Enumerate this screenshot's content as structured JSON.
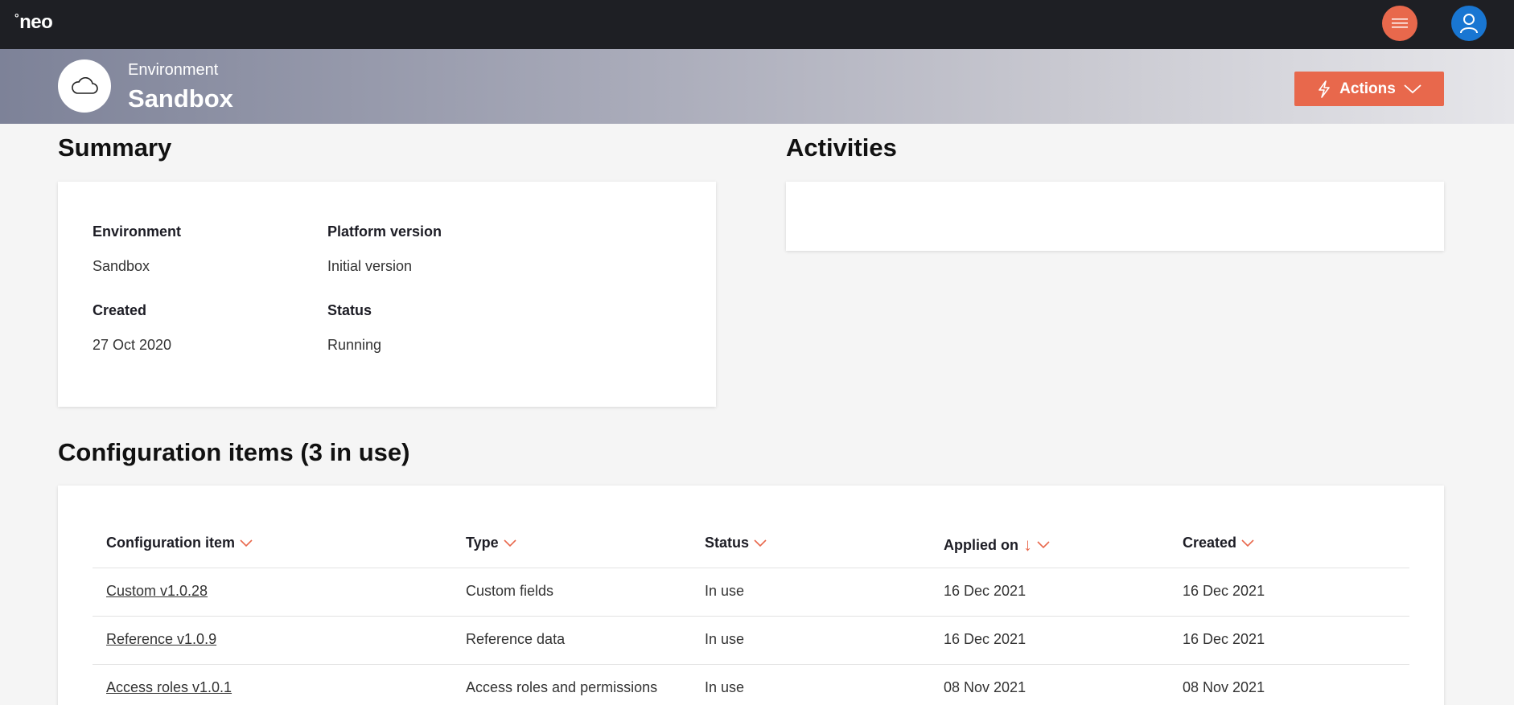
{
  "topbar": {
    "logo_mark": "°",
    "logo_text": "neo",
    "menu_icon": "hamburger-icon",
    "user_icon": "user-icon"
  },
  "hero": {
    "icon": "cloud-icon",
    "label": "Environment",
    "name": "Sandbox",
    "actions_label": "Actions"
  },
  "summary": {
    "title": "Summary",
    "fields": [
      {
        "label": "Environment",
        "value": "Sandbox"
      },
      {
        "label": "Platform version",
        "value": "Initial version"
      },
      {
        "label": "Created",
        "value": "27 Oct 2020"
      },
      {
        "label": "Status",
        "value": "Running"
      }
    ]
  },
  "activities": {
    "title": "Activities"
  },
  "config": {
    "title": "Configuration items (3 in use)",
    "columns": [
      "Configuration item",
      "Type",
      "Status",
      "Applied on",
      "Created"
    ],
    "sort_indicator": "↓",
    "rows": [
      {
        "item": "Custom v1.0.28",
        "type": "Custom fields",
        "status": "In use",
        "applied": "16 Dec 2021",
        "created": "16 Dec 2021"
      },
      {
        "item": "Reference v1.0.9",
        "type": "Reference data",
        "status": "In use",
        "applied": "16 Dec 2021",
        "created": "16 Dec 2021"
      },
      {
        "item": "Access roles v1.0.1",
        "type": "Access roles and permissions",
        "status": "In use",
        "applied": "08 Nov 2021",
        "created": "08 Nov 2021"
      }
    ]
  },
  "colors": {
    "accent": "#e8684c",
    "user_avatar": "#1976d2",
    "topbar": "#1e1f24"
  }
}
